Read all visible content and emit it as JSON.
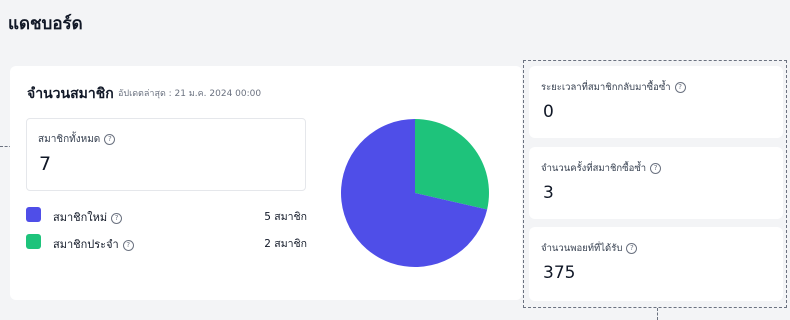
{
  "header": {
    "title": "แดชบอร์ด"
  },
  "members": {
    "title": "จำนวนสมาชิก",
    "updated": "อัปเดตล่าสุด : 21 ม.ค. 2024 00:00",
    "total": {
      "label": "สมาชิกทั้งหมด",
      "value": "7",
      "icon": "help-icon"
    },
    "legend": [
      {
        "label": "สมาชิกใหม่",
        "count": "5 สมาชิก",
        "color": "#4f4ee8",
        "icon": "help-icon"
      },
      {
        "label": "สมาชิกประจำ",
        "count": "2 สมาชิก",
        "color": "#1ec37b",
        "icon": "help-icon"
      }
    ],
    "pie": {
      "values": [
        5,
        2
      ],
      "colors": [
        "#4f4ee8",
        "#1ec37b"
      ]
    }
  },
  "stats": [
    {
      "label": "ระยะเวลาที่สมาชิกกลับมาซื้อซ้ำ",
      "value": "0",
      "icon": "help-icon"
    },
    {
      "label": "จำนวนครั้งที่สมาชิกซื้อซ้ำ",
      "value": "3",
      "icon": "help-icon"
    },
    {
      "label": "จำนวนพอยท์ที่ได้รับ",
      "value": "375",
      "icon": "help-icon"
    }
  ]
}
